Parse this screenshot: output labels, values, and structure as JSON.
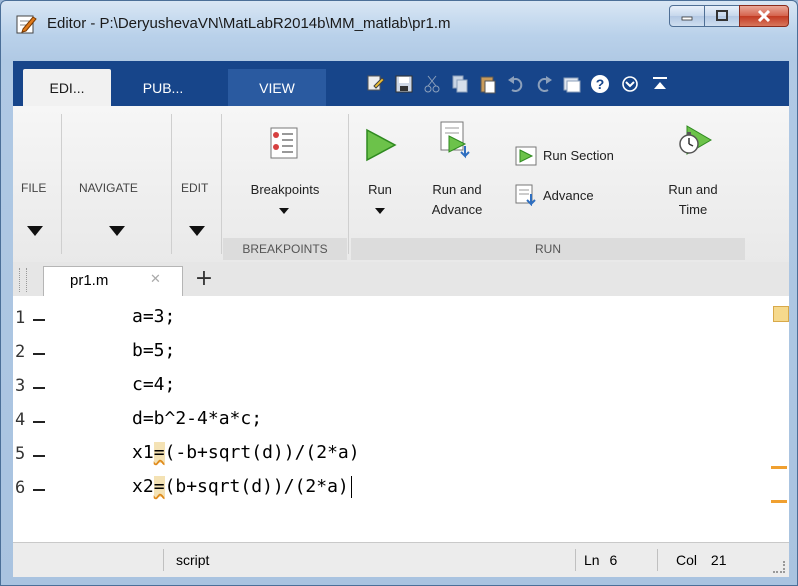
{
  "window": {
    "title": "Editor - P:\\DeryushevaVN\\MatLabR2014b\\MM_matlab\\pr1.m"
  },
  "ribbon_tabs": [
    {
      "label": "EDI..."
    },
    {
      "label": "PUB..."
    },
    {
      "label": "VIEW"
    }
  ],
  "quick_access_icons": [
    "new-script-icon",
    "save-icon",
    "cut-icon",
    "copy-icon",
    "paste-icon",
    "undo-icon",
    "redo-icon",
    "switch-windows-icon",
    "help-icon",
    "expand-icon",
    "minimize-ribbon-icon"
  ],
  "ribbon": {
    "file": "FILE",
    "navigate": "NAVIGATE",
    "edit": "EDIT",
    "breakpoints": "Breakpoints",
    "breakpoints_group": "BREAKPOINTS",
    "run": "Run",
    "run_and_advance_1": "Run and",
    "run_and_advance_2": "Advance",
    "run_section": "Run Section",
    "advance": "Advance",
    "run_and_time_1": "Run and",
    "run_and_time_2": "Time",
    "run_group": "RUN"
  },
  "doc_tab": {
    "label": "pr1.m",
    "close": "✕",
    "add": "+"
  },
  "code_lines": [
    {
      "num": "1",
      "text": "a=3;"
    },
    {
      "num": "2",
      "text": "b=5;"
    },
    {
      "num": "3",
      "text": "c=4;"
    },
    {
      "num": "4",
      "text": "d=b^2-4*a*c;"
    },
    {
      "num": "5",
      "pre": "x1",
      "hl": "=",
      "post": "(-b+sqrt(d))/(2*a)"
    },
    {
      "num": "6",
      "pre": "x2",
      "hl": "=",
      "post": "(b+sqrt(d))/(2*a)"
    }
  ],
  "status": {
    "mode": "script",
    "ln_label": "Ln",
    "ln": "6",
    "col_label": "Col",
    "col": "21"
  },
  "colors": {
    "tab_strip": "#17458a",
    "warning": "#f0a030"
  }
}
